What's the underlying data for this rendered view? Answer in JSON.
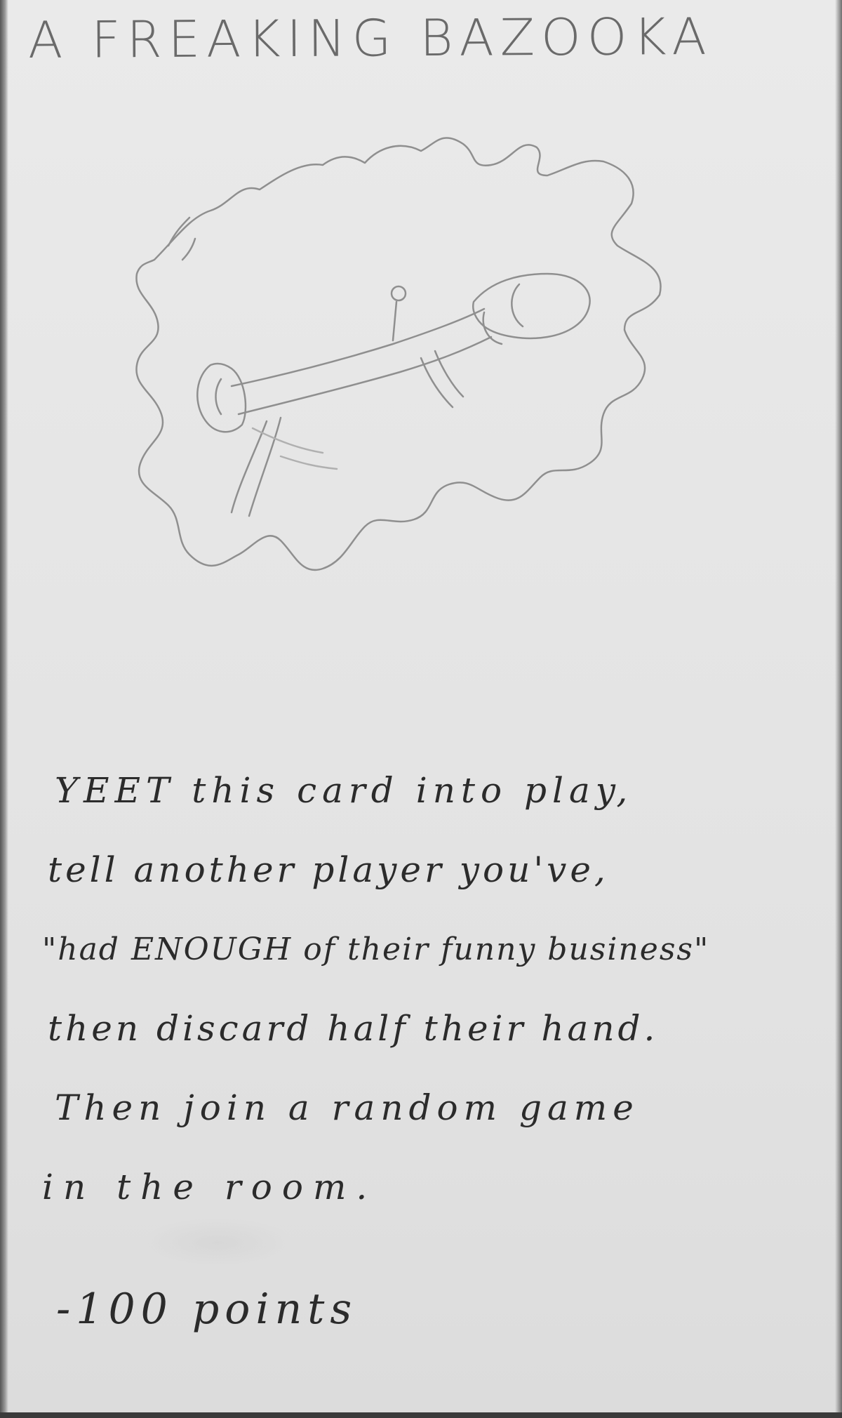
{
  "card": {
    "title": "A FREAKING BAZOOKA",
    "illustration_icon": "bazooka-explosion-sketch",
    "rules_lines": [
      "YEET this card into play,",
      "tell another player you've,",
      "\"had ENOUGH of their funny business\"",
      "then discard half their hand.",
      "Then join a random game",
      "in the room."
    ],
    "points": "-100 points"
  },
  "colors": {
    "paper": "#e6e6e6",
    "pencil": "#6a6a6a",
    "ink": "#2b2b2b"
  }
}
